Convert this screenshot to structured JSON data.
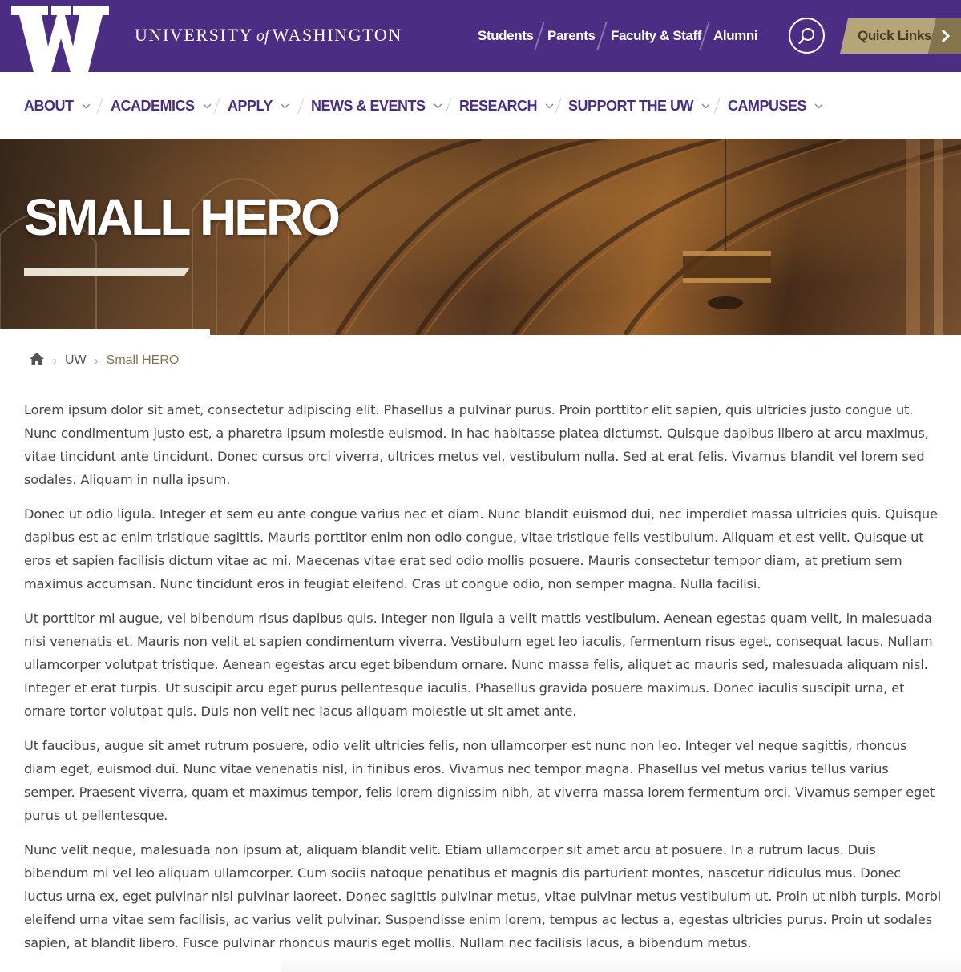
{
  "header": {
    "wordmark": {
      "university": "UNIVERSITY",
      "of": "of",
      "washington": "WASHINGTON"
    },
    "audience_links": [
      "Students",
      "Parents",
      "Faculty & Staff",
      "Alumni"
    ],
    "search_icon": "search-icon",
    "quick_links_label": "Quick Links",
    "colors": {
      "purple": "#4b2e83",
      "gold": "#b7a57a",
      "dark_gold": "#85754d"
    }
  },
  "nav": {
    "items": [
      "ABOUT",
      "ACADEMICS",
      "APPLY",
      "NEWS & EVENTS",
      "RESEARCH",
      "SUPPORT THE UW",
      "CAMPUSES"
    ]
  },
  "hero": {
    "title": "SMALL HERO"
  },
  "breadcrumb": {
    "home_icon": "home-icon",
    "parent": "UW",
    "current": "Small HERO"
  },
  "content": {
    "paragraphs": [
      "Lorem ipsum dolor sit amet, consectetur adipiscing elit. Phasellus a pulvinar purus. Proin porttitor elit sapien, quis ultricies justo congue ut. Nunc condimentum justo est, a pharetra ipsum molestie euismod. In hac habitasse platea dictumst. Quisque dapibus libero at arcu maximus, vitae tincidunt ante tincidunt. Donec cursus orci viverra, ultrices metus vel, vestibulum nulla. Sed at erat felis. Vivamus blandit vel lorem sed sodales. Aliquam in nulla ipsum.",
      "Donec ut odio ligula. Integer et sem eu ante congue varius nec et diam. Nunc blandit euismod dui, nec imperdiet massa ultricies quis. Quisque dapibus est ac enim tristique sagittis. Mauris porttitor enim non odio congue, vitae tristique felis vestibulum. Aliquam et est velit. Quisque ut eros et sapien facilisis dictum vitae ac mi. Maecenas vitae erat sed odio mollis posuere. Mauris consectetur tempor diam, at pretium sem maximus accumsan. Nunc tincidunt eros in feugiat eleifend. Cras ut congue odio, non semper magna. Nulla facilisi.",
      "Ut porttitor mi augue, vel bibendum risus dapibus quis. Integer non ligula a velit mattis vestibulum. Aenean egestas quam velit, in malesuada nisi venenatis et. Mauris non velit et sapien condimentum viverra. Vestibulum eget leo iaculis, fermentum risus eget, consequat lacus. Nullam ullamcorper volutpat tristique. Aenean egestas arcu eget bibendum ornare. Nunc massa felis, aliquet ac mauris sed, malesuada aliquam nisl. Integer et erat turpis. Ut suscipit arcu eget purus pellentesque iaculis. Phasellus gravida posuere maximus. Donec iaculis suscipit urna, et ornare tortor volutpat quis. Duis non velit nec lacus aliquam molestie ut sit amet ante.",
      "Ut faucibus, augue sit amet rutrum posuere, odio velit ultricies felis, non ullamcorper est nunc non leo. Integer vel neque sagittis, rhoncus diam eget, euismod dui. Nunc vitae venenatis nisl, in finibus eros. Vivamus nec tempor magna. Phasellus vel metus varius tellus varius semper. Praesent viverra, quam et maximus tempor, felis lorem dignissim nibh, at viverra massa lorem fermentum orci. Vivamus semper eget purus ut pellentesque.",
      "Nunc velit neque, malesuada non ipsum at, aliquam blandit velit. Etiam ullamcorper sit amet arcu at posuere. In a rutrum lacus. Duis bibendum mi vel leo aliquam ullamcorper. Cum sociis natoque penatibus et magnis dis parturient montes, nascetur ridiculus mus. Donec luctus urna ex, eget pulvinar nisl pulvinar laoreet. Donec sagittis pulvinar metus, vitae pulvinar metus vestibulum ut. Proin ut nibh turpis. Morbi eleifend urna vitae sem facilisis, ac varius velit pulvinar. Suspendisse enim lorem, tempus ac lectus a, egestas ultricies purus. Proin ut sodales sapien, at blandit libero. Fusce pulvinar rhoncus mauris eget mollis. Nullam nec facilisis lacus, a bibendum metus."
    ]
  }
}
